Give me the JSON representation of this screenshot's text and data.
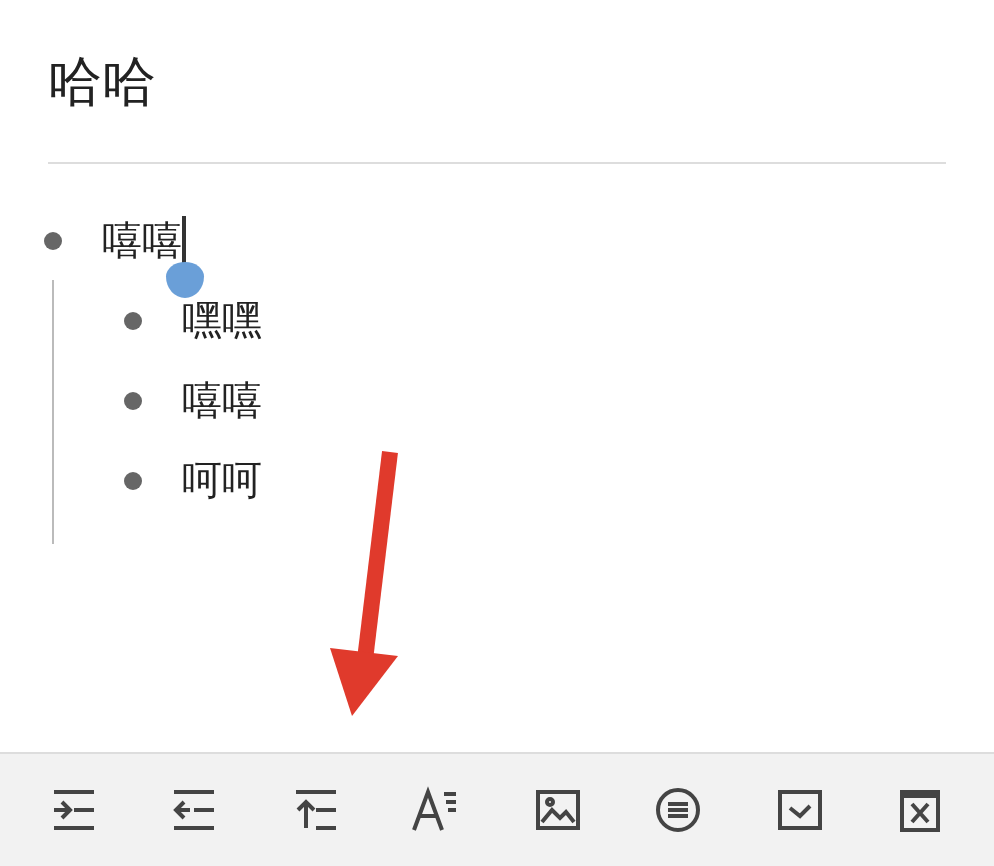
{
  "note": {
    "title": "哈哈"
  },
  "outline": [
    {
      "text": "嘻嘻",
      "children": [
        {
          "text": "嘿嘿"
        },
        {
          "text": "嘻嘻"
        },
        {
          "text": "呵呵"
        }
      ]
    }
  ]
}
